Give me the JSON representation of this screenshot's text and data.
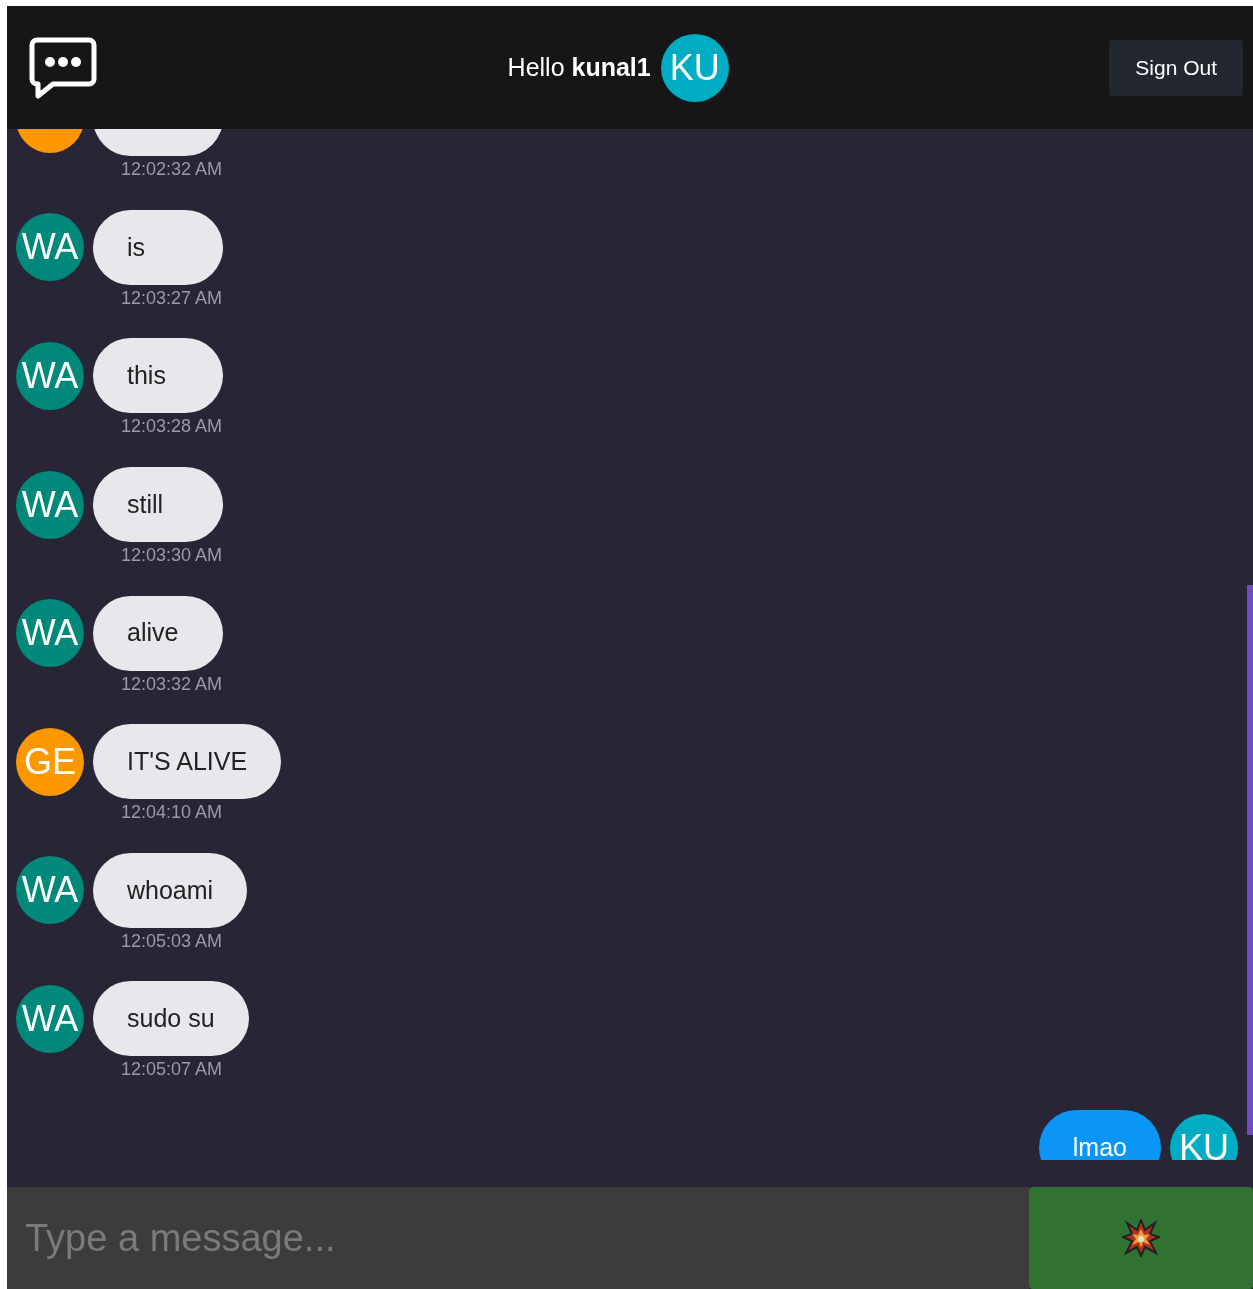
{
  "header": {
    "greeting": "Hello **kunal1**",
    "avatar": "KU",
    "sign_out": "Sign Out"
  },
  "messages": [
    {
      "kind": "received",
      "color": "#ff9800",
      "time": "12:02:32 AM"
    },
    {
      "kind": "received",
      "avatar": "WA",
      "color": "#00897b",
      "text": "is",
      "time": "12:03:27 AM"
    },
    {
      "kind": "received",
      "avatar": "WA",
      "color": "#00897b",
      "text": "this",
      "time": "12:03:28 AM"
    },
    {
      "kind": "received",
      "avatar": "WA",
      "color": "#00897b",
      "text": "still",
      "time": "12:03:30 AM"
    },
    {
      "kind": "received",
      "avatar": "WA",
      "color": "#00897b",
      "text": "alive",
      "time": "12:03:32 AM"
    },
    {
      "kind": "received",
      "avatar": "GE",
      "color": "#ff9800",
      "text": "IT'S ALIVE",
      "time": "12:04:10 AM"
    },
    {
      "kind": "received",
      "avatar": "WA",
      "color": "#00897b",
      "text": "whoami",
      "time": "12:05:03 AM"
    },
    {
      "kind": "received",
      "avatar": "WA",
      "color": "#00897b",
      "text": "sudo su",
      "time": "12:05:07 AM"
    },
    {
      "kind": "sent",
      "avatar": "KU",
      "color": "#00acc1",
      "text": "lmao"
    }
  ],
  "composer": {
    "placeholder": "Type a message..."
  }
}
